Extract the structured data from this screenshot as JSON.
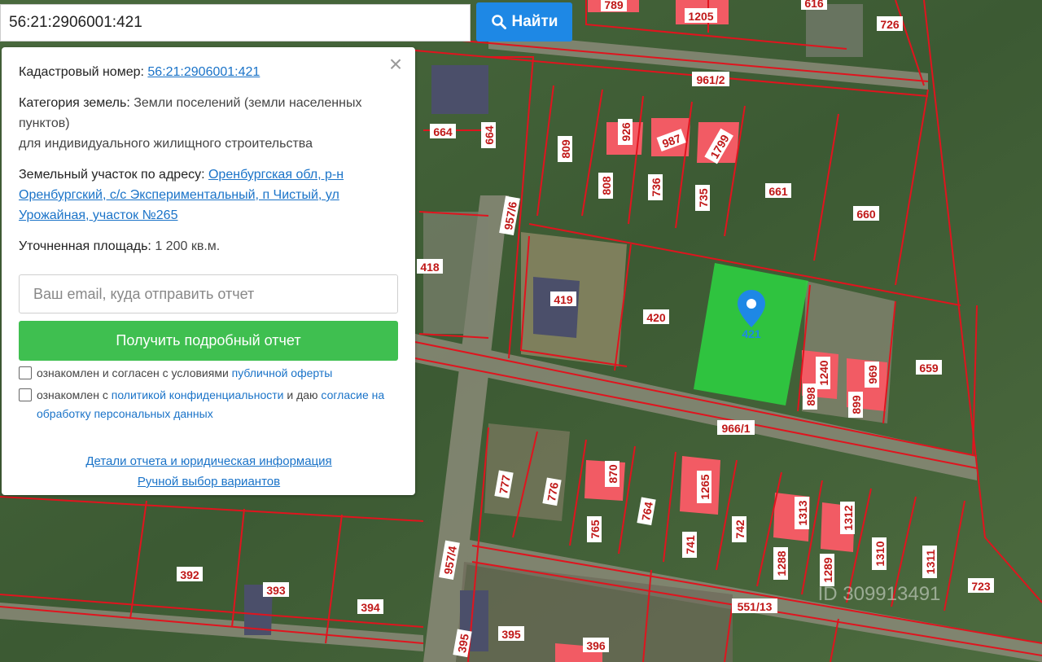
{
  "search": {
    "value": "56:21:2906001:421",
    "button_label": "Найти"
  },
  "card": {
    "cadastral_label": "Кадастровый номер:",
    "cadastral_value": "56:21:2906001:421",
    "category_label": "Категория земель:",
    "category_value": "Земли поселений (земли населенных пунктов)",
    "category_use": "для индивидуального жилищного строительства",
    "address_label": "Земельный участок по адресу:",
    "address_value": "Оренбургская обл, р-н Оренбургский, с/с Экспериментальный, п Чистый, ул Урожайная, участок №265",
    "area_label": "Уточненная площадь:",
    "area_value": "1 200 кв.м.",
    "email_placeholder": "Ваш email, куда отправить отчет",
    "report_button": "Получить подробный отчет",
    "agree1_text": "ознакомлен и согласен с условиями",
    "agree1_link": "публичной оферты",
    "agree2_text_a": "ознакомлен с",
    "agree2_link_a": "политикой конфиденциальности",
    "agree2_text_b": "и даю",
    "agree2_link_b": "согласие на обработку персональных данных",
    "link_details": "Детали отчета и юридическая информация",
    "link_manual": "Ручной выбор вариантов"
  },
  "map": {
    "selected_plot": "421",
    "selected_color": "#2ecc40",
    "border_color": "#e0141e",
    "roof_color": "#f25b64",
    "labels": {
      "l789": "789",
      "l1205": "1205",
      "l616": "616",
      "l726": "726",
      "l961_2": "961/2",
      "l664a": "664",
      "l664b": "664",
      "l809": "809",
      "l926": "926",
      "l987": "987",
      "l1799": "1799",
      "l808": "808",
      "l736": "736",
      "l735": "735",
      "l661": "661",
      "l660": "660",
      "l957_6": "957/6",
      "l418": "418",
      "l419": "419",
      "l420": "420",
      "l1240": "1240",
      "l969": "969",
      "l659": "659",
      "l898": "898",
      "l899": "899",
      "l966_1": "966/1",
      "l777": "777",
      "l776": "776",
      "l870": "870",
      "l1265": "1265",
      "l765": "765",
      "l764": "764",
      "l741": "741",
      "l742": "742",
      "l1313": "1313",
      "l1312": "1312",
      "l1288": "1288",
      "l1289": "1289",
      "l1310": "1310",
      "l1311": "1311",
      "l723": "723",
      "l392": "392",
      "l393": "393",
      "l394": "394",
      "l957_4": "957/4",
      "l551_13": "551/13",
      "l395a": "395",
      "l395b": "395",
      "l396": "396"
    },
    "watermark": "ID 309913491"
  }
}
